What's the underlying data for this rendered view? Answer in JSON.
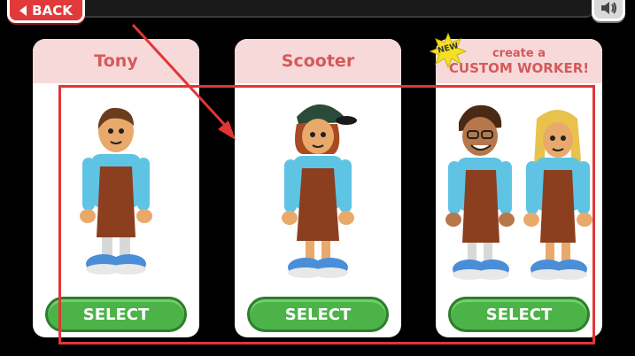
{
  "top_bar": {
    "back_label": "BACK"
  },
  "cards": [
    {
      "name": "Tony",
      "button_label": "SELECT"
    },
    {
      "name": "Scooter",
      "button_label": "SELECT"
    },
    {
      "title_line1": "create a",
      "title_line2": "CUSTOM WORKER!",
      "badge": "NEW",
      "button_label": "SELECT"
    }
  ],
  "colors": {
    "back_button": "#e23a3a",
    "card_header": "#f7d9da",
    "card_title_text": "#d45a5a",
    "select_button": "#4bb348",
    "annotation": "#e23535",
    "shirt": "#5fc3e4",
    "apron": "#8b3f1f"
  },
  "icons": [
    "back-arrow-icon",
    "speaker-icon",
    "new-badge-icon"
  ]
}
